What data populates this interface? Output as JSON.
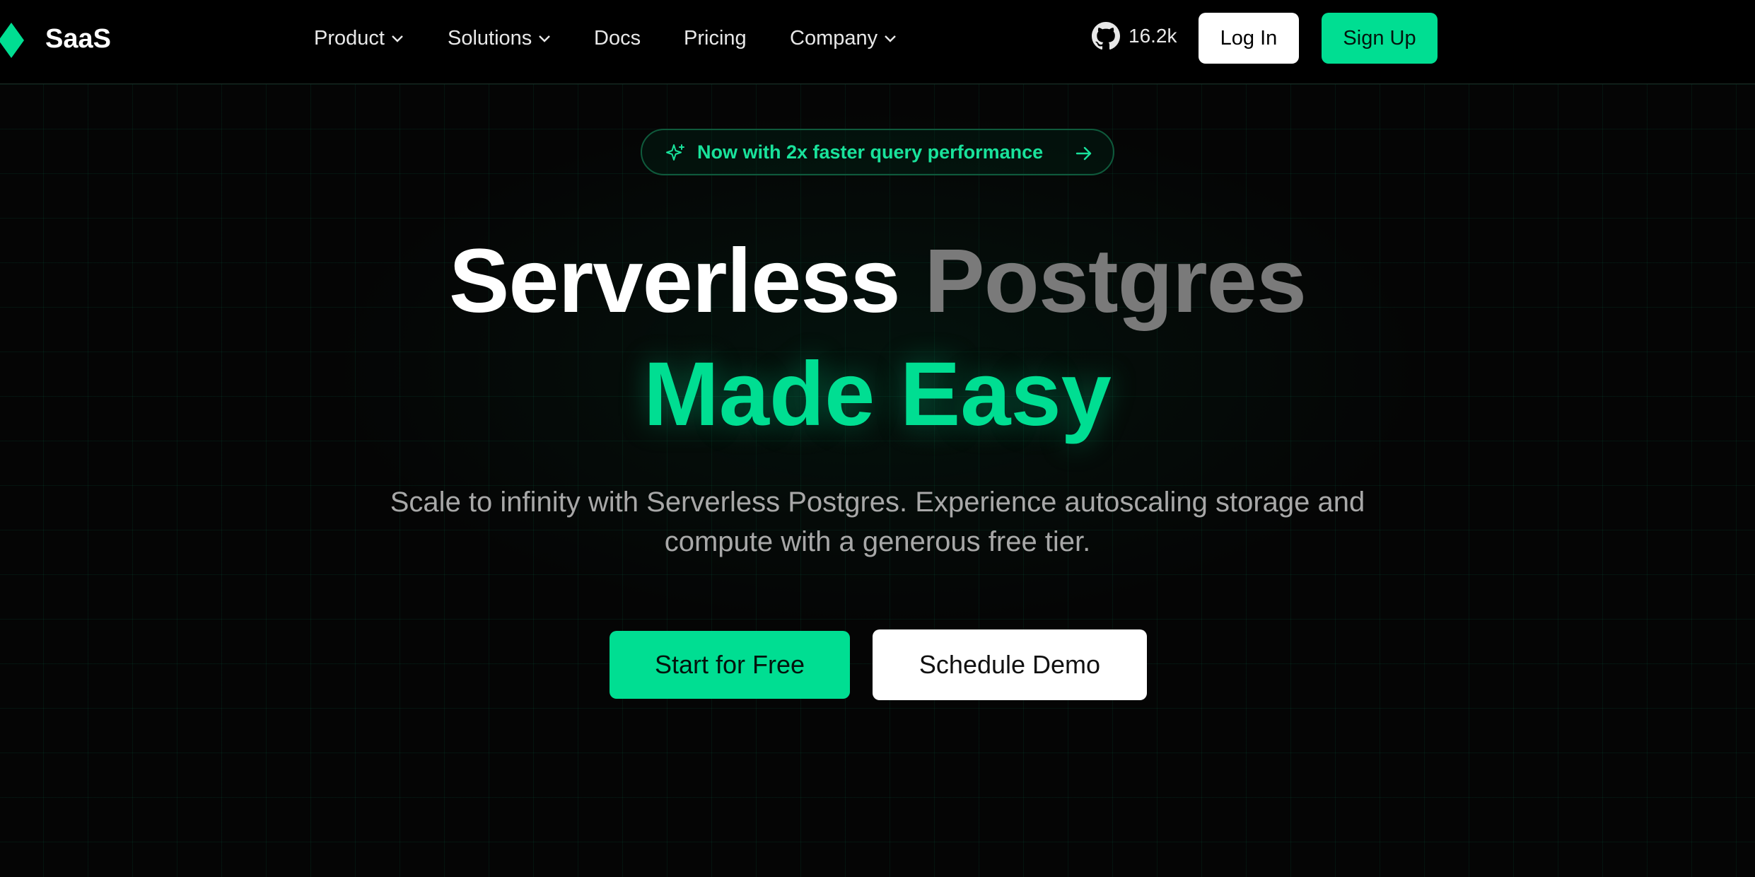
{
  "brand": {
    "name": "SaaS",
    "accent": "#00de92",
    "logo_icon": "diamond-logo-icon"
  },
  "nav": {
    "items": [
      {
        "label": "Product",
        "has_dropdown": true
      },
      {
        "label": "Solutions",
        "has_dropdown": true
      },
      {
        "label": "Docs",
        "has_dropdown": false
      },
      {
        "label": "Pricing",
        "has_dropdown": false
      },
      {
        "label": "Company",
        "has_dropdown": true
      }
    ],
    "github_stars": "16.2k",
    "github_icon": "github-icon",
    "login_label": "Log In",
    "signup_label": "Sign Up"
  },
  "announcement": {
    "text": "Now with 2x faster query performance",
    "icon": "sparkle-icon"
  },
  "hero": {
    "title_white": "Serverless",
    "title_gray": "Postgres",
    "title_accent": "Made Easy",
    "subtitle_line1": "Scale to infinity with Serverless Postgres. Experience autoscaling storage and",
    "subtitle_line2": "compute with a generous free tier.",
    "primary_cta": "Start for Free",
    "secondary_cta": "Schedule Demo"
  }
}
